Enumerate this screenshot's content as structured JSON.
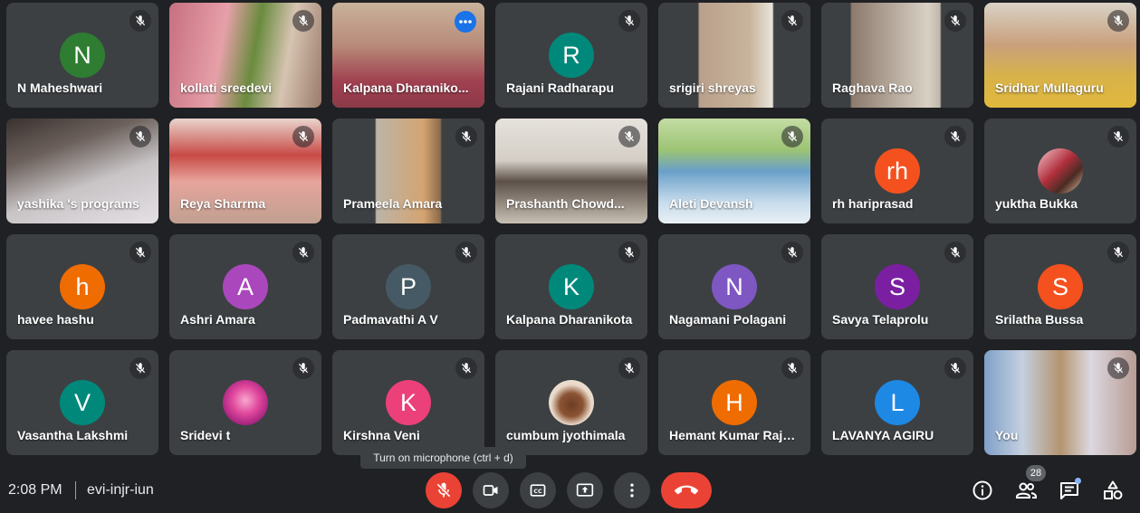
{
  "participants": [
    {
      "name": "N Maheshwari",
      "initial": "N",
      "color": "#2e7d32",
      "type": "avatar"
    },
    {
      "name": "kollati sreedevi",
      "type": "video",
      "bg": "linear-gradient(100deg,#c76f80 0%,#e6a0a8 35%,#6a8b3e 55%,#d7c4b2 75%,#9a7b6a 100%)"
    },
    {
      "name": "Kalpana Dharaniko...",
      "type": "video",
      "active": true,
      "bg": "linear-gradient(180deg,#c9b29a 0%,#b88c7a 40%,#a04050 75%,#8c3a48 100%)"
    },
    {
      "name": "Rajani Radharapu",
      "initial": "R",
      "color": "#00897b",
      "type": "avatar"
    },
    {
      "name": "srigiri shreyas",
      "type": "video",
      "bg": "linear-gradient(90deg,#3c4043 0%,#3c4043 26%,#b9a08c 27%,#c8b49c 60%,#e9e4da 75%,#3c4043 76%)"
    },
    {
      "name": "Raghava Rao",
      "type": "video",
      "bg": "linear-gradient(90deg,#3c4043 0%,#3c4043 19%,#8c7a6c 20%,#d8d0c4 70%,#c0b8ac 78%,#3c4043 79%)"
    },
    {
      "name": "Sridhar Mullaguru",
      "type": "video",
      "bg": "linear-gradient(180deg,#d9d2c6 0%,#c9a07c 40%,#d8b24a 70%,#e0b83c 100%)"
    },
    {
      "name": "yashika 's programs",
      "type": "video",
      "bg": "linear-gradient(160deg,#3a3230 0%,#6c615c 30%,#c8c4c6 60%,#e4e0e4 100%)"
    },
    {
      "name": "Reya Sharrma",
      "type": "video",
      "bg": "linear-gradient(180deg,#e9d4cc 0%,#c84a46 35%,#e6a49c 60%,#c0a090 100%)"
    },
    {
      "name": "Prameela Amara",
      "type": "video",
      "bg": "linear-gradient(90deg,#3c4043 0%,#3c4043 28%,#bcb4a8 29%,#d4a470 60%,#8a6a4c 71%,#3c4043 72%)"
    },
    {
      "name": "Prashanth Chowd...",
      "type": "video",
      "bg": "linear-gradient(180deg,#e6e2dc 0%,#d4cec6 40%,#5c5048 60%,#c8c0b4 100%)"
    },
    {
      "name": "Aleti Devansh",
      "type": "video",
      "bg": "linear-gradient(180deg,#c4dca4 0%,#9cc474 30%,#6aa0c8 50%,#c8dcec 80%,#e8f0f4 100%)"
    },
    {
      "name": "rh hariprasad",
      "initial": "rh",
      "color": "#f4511e",
      "type": "avatar"
    },
    {
      "name": "yuktha Bukka",
      "type": "photo",
      "photoBg": "linear-gradient(135deg,#f4c4cc 0%,#b0303c 45%,#4a2c24 70%,#e8c0a4 100%)"
    },
    {
      "name": "havee hashu",
      "initial": "h",
      "color": "#ef6c00",
      "type": "avatar"
    },
    {
      "name": "Ashri Amara",
      "initial": "A",
      "color": "#ab47bc",
      "type": "avatar"
    },
    {
      "name": "Padmavathi A V",
      "initial": "P",
      "color": "#455a64",
      "type": "avatar"
    },
    {
      "name": "Kalpana Dharanikota",
      "initial": "K",
      "color": "#00897b",
      "type": "avatar"
    },
    {
      "name": "Nagamani Polagani",
      "initial": "N",
      "color": "#7e57c2",
      "type": "avatar"
    },
    {
      "name": "Savya Telaprolu",
      "initial": "S",
      "color": "#7b1fa2",
      "type": "avatar"
    },
    {
      "name": "Srilatha Bussa",
      "initial": "S",
      "color": "#f4511e",
      "type": "avatar"
    },
    {
      "name": "Vasantha Lakshmi",
      "initial": "V",
      "color": "#00897b",
      "type": "avatar"
    },
    {
      "name": "Sridevi t",
      "type": "photo",
      "photoBg": "radial-gradient(circle at 50% 45%,#f8a8d0 0%,#e0489c 40%,#a0207c 75%,#5c1848 100%)"
    },
    {
      "name": "Kirshna Veni",
      "initial": "K",
      "color": "#ec407a",
      "type": "avatar"
    },
    {
      "name": "cumbum jyothimala",
      "type": "photo",
      "photoBg": "radial-gradient(circle at 50% 55%,#6c3c24 0%,#8c5434 35%,#e8d8c8 60%,#f4ece4 100%)"
    },
    {
      "name": "Hemant Kumar Rajole",
      "initial": "H",
      "color": "#ef6c00",
      "type": "avatar"
    },
    {
      "name": "LAVANYA AGIRU",
      "initial": "L",
      "color": "#1e88e5",
      "type": "avatar"
    },
    {
      "name": "You",
      "type": "video",
      "bg": "linear-gradient(90deg,#7fa0c8 0%,#c4d0e0 25%,#b49470 50%,#dcd8e0 70%,#b89c94 100%)"
    }
  ],
  "tooltip": "Turn on microphone (ctrl + d)",
  "bottom": {
    "time": "2:08 PM",
    "meeting_code": "evi-injr-iun",
    "participants_count": "28"
  },
  "icons": {
    "muted": "mic-off-icon",
    "more": "more-options-icon",
    "camera": "camera-icon",
    "captions": "captions-icon",
    "present": "present-screen-icon",
    "more_vert": "more-vert-icon",
    "end_call": "end-call-icon",
    "info": "info-icon",
    "people": "people-icon",
    "chat": "chat-icon",
    "activities": "activities-icon"
  },
  "colors": {
    "background": "#202124",
    "tile": "#3c4043",
    "danger": "#ea4335",
    "accent": "#8ab4f8"
  }
}
